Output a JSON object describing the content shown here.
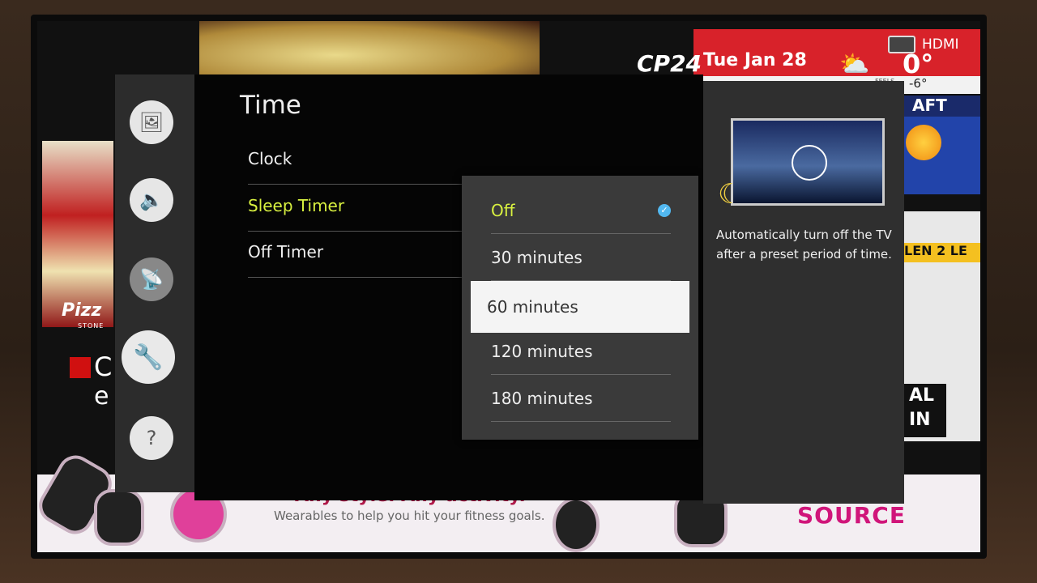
{
  "background": {
    "broadcast": {
      "channel_logo": "CP24",
      "date": "Tue Jan 28",
      "temperature": "0°",
      "feels_label": "FEELS",
      "feels_value": "-6°",
      "input_label": "HDMI",
      "ticker_fragment_1": "AFT",
      "ticker_fragment_2": "LEN 2 LE",
      "ticker_fragment_3": "AL",
      "ticker_fragment_4": "IN",
      "left_fragment": "C",
      "left_fragment_2": "e",
      "pizza_logo": "Pizz",
      "pizza_sub": "STONE"
    },
    "ad": {
      "headline": "Any style. Any activity.",
      "subline": "Wearables to help you hit your fitness goals.",
      "brand": "SOURCE"
    }
  },
  "menu": {
    "sidebar": [
      {
        "icon": "picture-icon"
      },
      {
        "icon": "sound-icon"
      },
      {
        "icon": "broadcasting-icon"
      },
      {
        "icon": "general-wrench-icon",
        "selected": true
      },
      {
        "icon": "support-icon"
      }
    ],
    "title": "Time",
    "items": [
      {
        "label": "Clock"
      },
      {
        "label": "Sleep Timer",
        "active": true
      },
      {
        "label": "Off Timer"
      }
    ],
    "dropdown": {
      "options": [
        "Off",
        "30 minutes",
        "60 minutes",
        "120 minutes",
        "180 minutes"
      ],
      "checked": "Off",
      "focused": "60 minutes"
    },
    "info": {
      "description": "Automatically turn off the TV after a preset period of time."
    }
  },
  "colors": {
    "accent_active": "#d8f040",
    "check": "#52b8f0",
    "cp24_red": "#d8222a",
    "ad_brand": "#d0157a"
  }
}
